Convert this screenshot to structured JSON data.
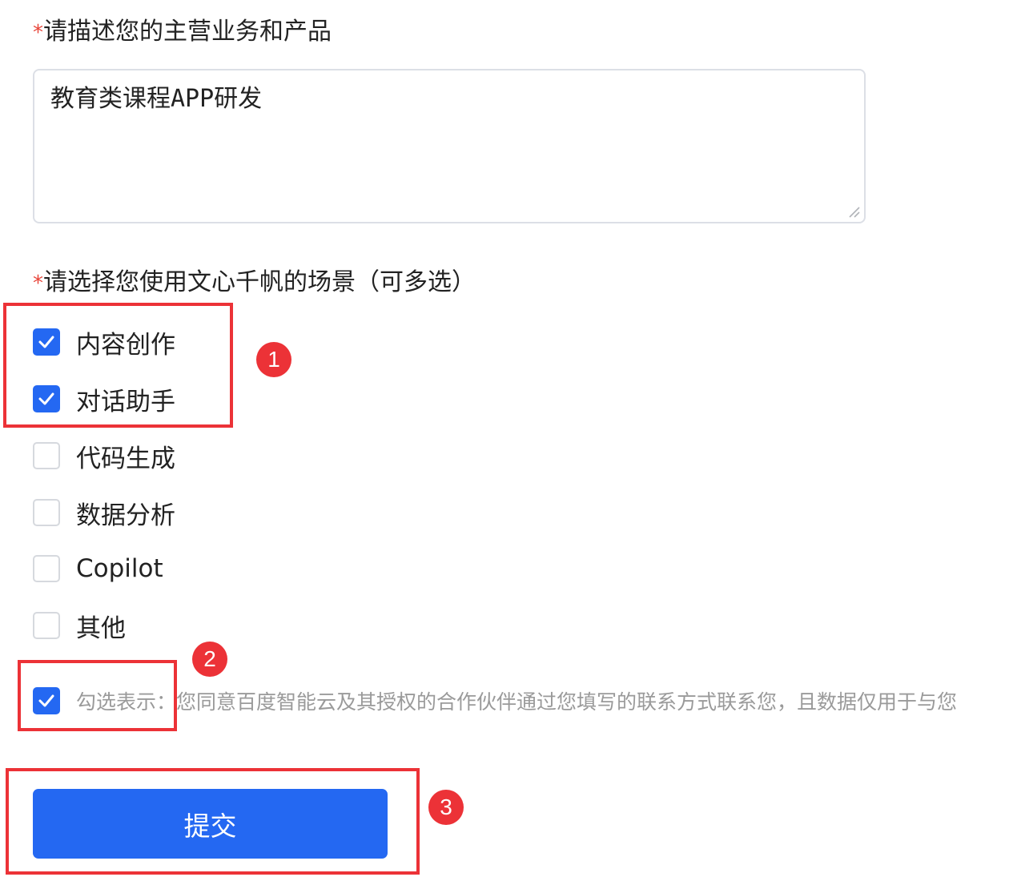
{
  "business_field": {
    "required_mark": "*",
    "label": "请描述您的主营业务和产品",
    "value": "教育类课程APP研发"
  },
  "scenario_field": {
    "required_mark": "*",
    "label": "请选择您使用文心千帆的场景（可多选）",
    "options": [
      {
        "label": "内容创作",
        "checked": true
      },
      {
        "label": "对话助手",
        "checked": true
      },
      {
        "label": "代码生成",
        "checked": false
      },
      {
        "label": "数据分析",
        "checked": false
      },
      {
        "label": "Copilot",
        "checked": false
      },
      {
        "label": "其他",
        "checked": false
      }
    ]
  },
  "agreement": {
    "checked": true,
    "text": "勾选表示：您同意百度智能云及其授权的合作伙伴通过您填写的联系方式联系您，且数据仅用于与您"
  },
  "submit": {
    "label": "提交"
  },
  "annotations": {
    "badge_1": "1",
    "badge_2": "2",
    "badge_3": "3",
    "color": "#ec3237"
  },
  "colors": {
    "primary": "#2468f2",
    "required": "#e8463b",
    "muted_text": "#9a9a9a"
  }
}
